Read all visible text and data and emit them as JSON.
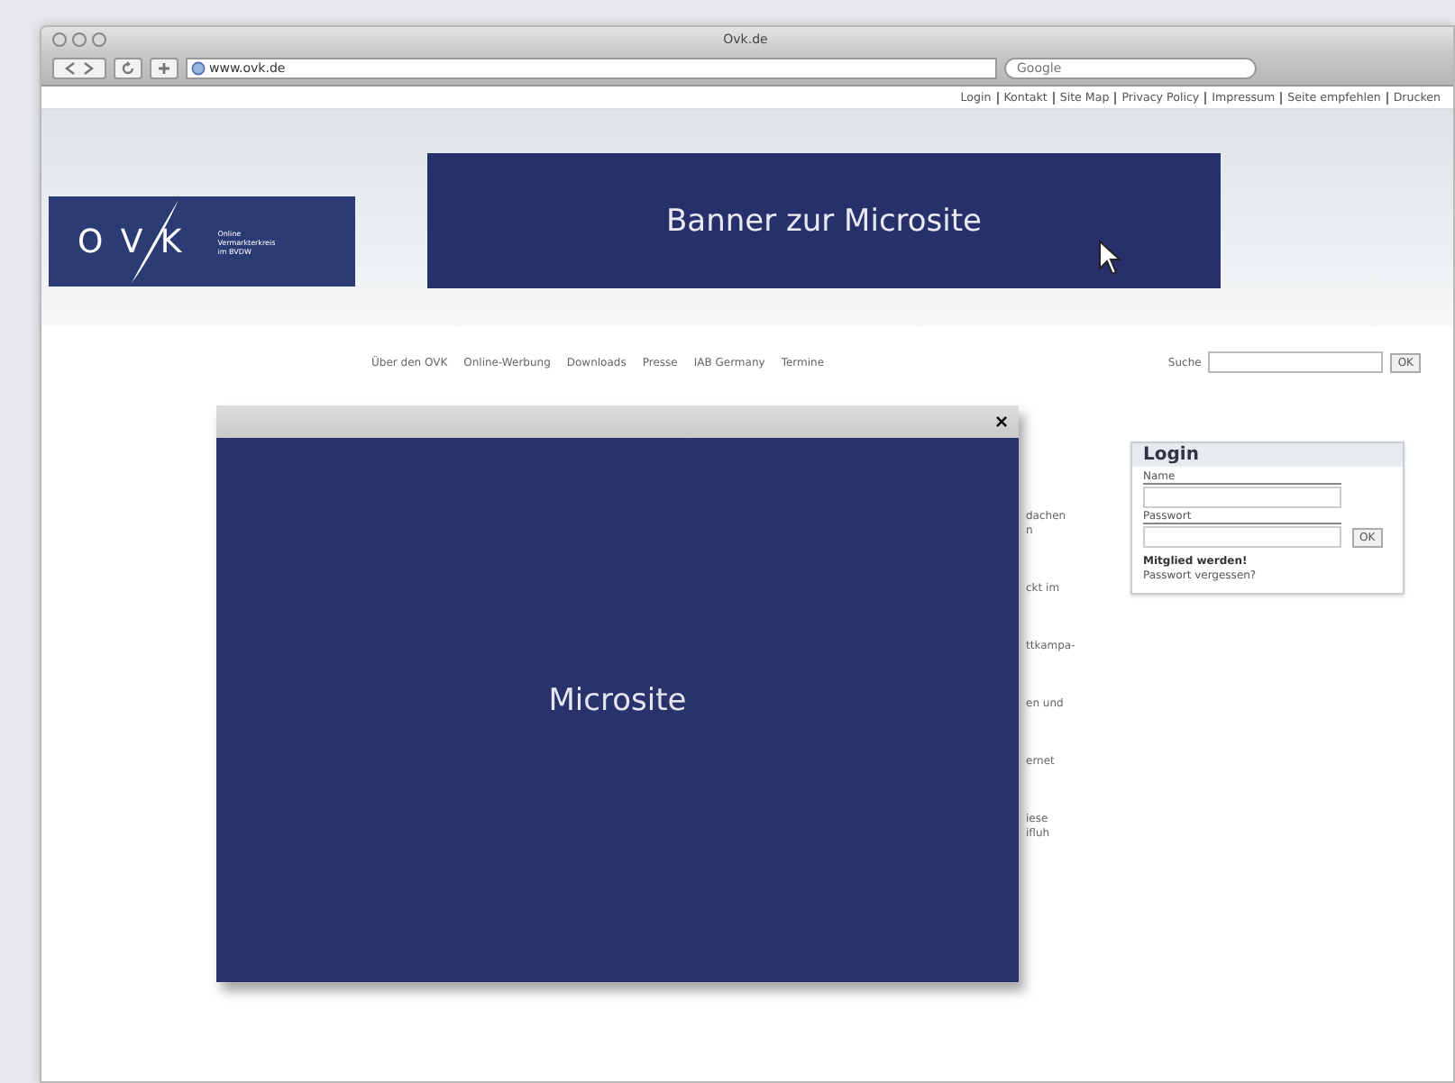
{
  "window": {
    "title": "Ovk.de"
  },
  "toolbar": {
    "address": "www.ovk.de",
    "search_placeholder": "Google"
  },
  "top_links": [
    "Login",
    "Kontakt",
    "Site Map",
    "Privacy Policy",
    "Impressum",
    "Seite empfehlen",
    "Drucken"
  ],
  "logo": {
    "letters": "O V K",
    "tagline": [
      "Online",
      "Vermarkterkreis",
      "im BVDW"
    ]
  },
  "banner": {
    "text": "Banner zur Microsite"
  },
  "nav": [
    "Über den OVK",
    "Online-Werbung",
    "Downloads",
    "Presse",
    "IAB Germany",
    "Termine"
  ],
  "search": {
    "label": "Suche",
    "button": "OK"
  },
  "content_fragments": [
    [
      "dachen",
      "n"
    ],
    [
      "ckt im"
    ],
    [
      "ttkampa-"
    ],
    [
      "en und"
    ],
    [
      "ernet"
    ],
    [
      "iese",
      "ifluh"
    ]
  ],
  "login": {
    "title": "Login",
    "name_label": "Name",
    "password_label": "Passwort",
    "button": "OK",
    "register": "Mitglied werden!",
    "forgot": "Passwort vergessen?"
  },
  "modal": {
    "close": "×",
    "text": "Microsite"
  }
}
